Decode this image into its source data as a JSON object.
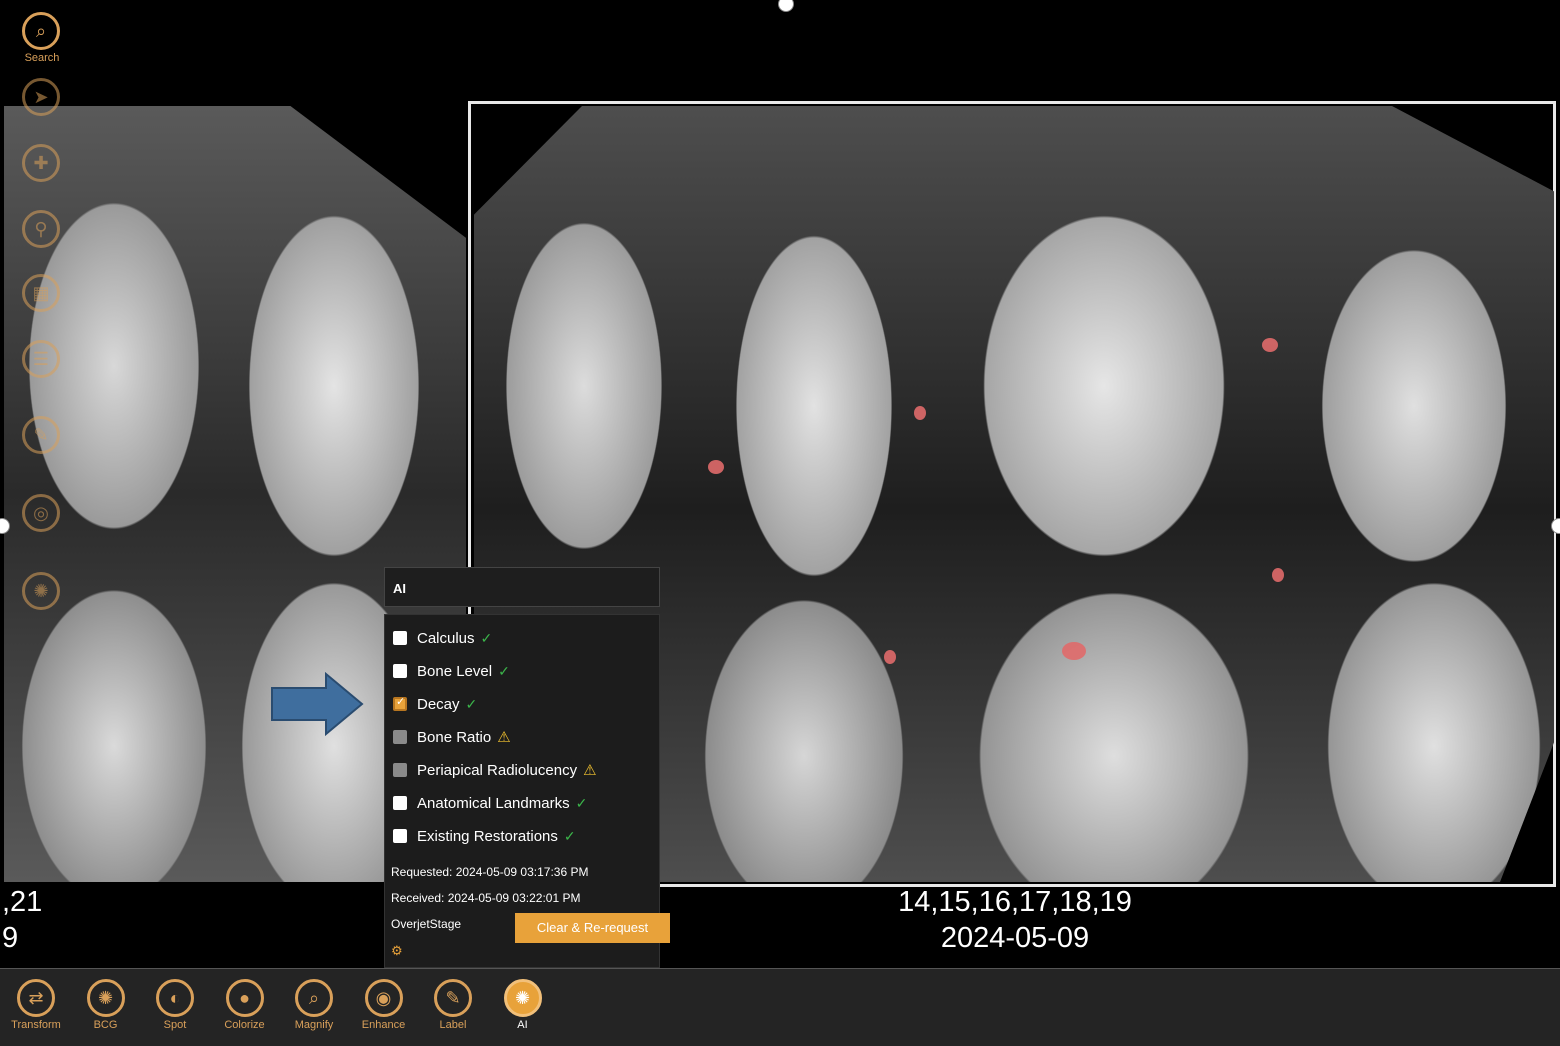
{
  "colors": {
    "accent": "#e8a23a",
    "detection": "#e06a6a",
    "ok": "#3bb44a",
    "warn": "#f2c230",
    "arrow": "#3f6e9e"
  },
  "left_tools": [
    {
      "label": "Search",
      "icon": "search-icon"
    },
    {
      "label": "",
      "icon": "cursor-icon"
    },
    {
      "label": "",
      "icon": "target-icon"
    },
    {
      "label": "",
      "icon": "tool-icon"
    },
    {
      "label": "",
      "icon": "layers-icon"
    },
    {
      "label": "",
      "icon": "series-icon"
    },
    {
      "label": "",
      "icon": "edit-icon"
    },
    {
      "label": "",
      "icon": "circle-icon"
    },
    {
      "label": "",
      "icon": "settings-icon"
    }
  ],
  "captions": {
    "left_line1": ",21",
    "left_line2": "9",
    "right_line1": "14,15,16,17,18,19",
    "right_line2": "2024-05-09"
  },
  "ai_panel": {
    "title": "AI",
    "options": [
      {
        "label": "Calculus",
        "state": "unchecked",
        "status": "ok"
      },
      {
        "label": "Bone Level",
        "state": "unchecked",
        "status": "ok"
      },
      {
        "label": "Decay",
        "state": "checked",
        "status": "ok"
      },
      {
        "label": "Bone Ratio",
        "state": "disabled",
        "status": "warn"
      },
      {
        "label": "Periapical Radiolucency",
        "state": "disabled",
        "status": "warn"
      },
      {
        "label": "Anatomical Landmarks",
        "state": "unchecked",
        "status": "ok"
      },
      {
        "label": "Existing Restorations",
        "state": "unchecked",
        "status": "ok"
      }
    ],
    "requested": "Requested: 2024-05-09 03:17:36 PM",
    "received": "Received: 2024-05-09 03:22:01 PM",
    "stage": "OverjetStage",
    "rerequest_label": "Clear & Re-request"
  },
  "toolbar": [
    {
      "label": "Transform",
      "icon": "transform-icon",
      "glyph": "⇄"
    },
    {
      "label": "BCG",
      "icon": "bcg-icon",
      "glyph": "✺"
    },
    {
      "label": "Spot",
      "icon": "spot-icon",
      "glyph": "◐"
    },
    {
      "label": "Colorize",
      "icon": "drop-icon",
      "glyph": "●"
    },
    {
      "label": "Magnify",
      "icon": "magnify-icon",
      "glyph": "⌕"
    },
    {
      "label": "Enhance",
      "icon": "eye-icon",
      "glyph": "◉"
    },
    {
      "label": "Label",
      "icon": "label-icon",
      "glyph": "✎"
    },
    {
      "label": "AI",
      "icon": "ai-icon",
      "glyph": "✺",
      "active": true
    }
  ]
}
